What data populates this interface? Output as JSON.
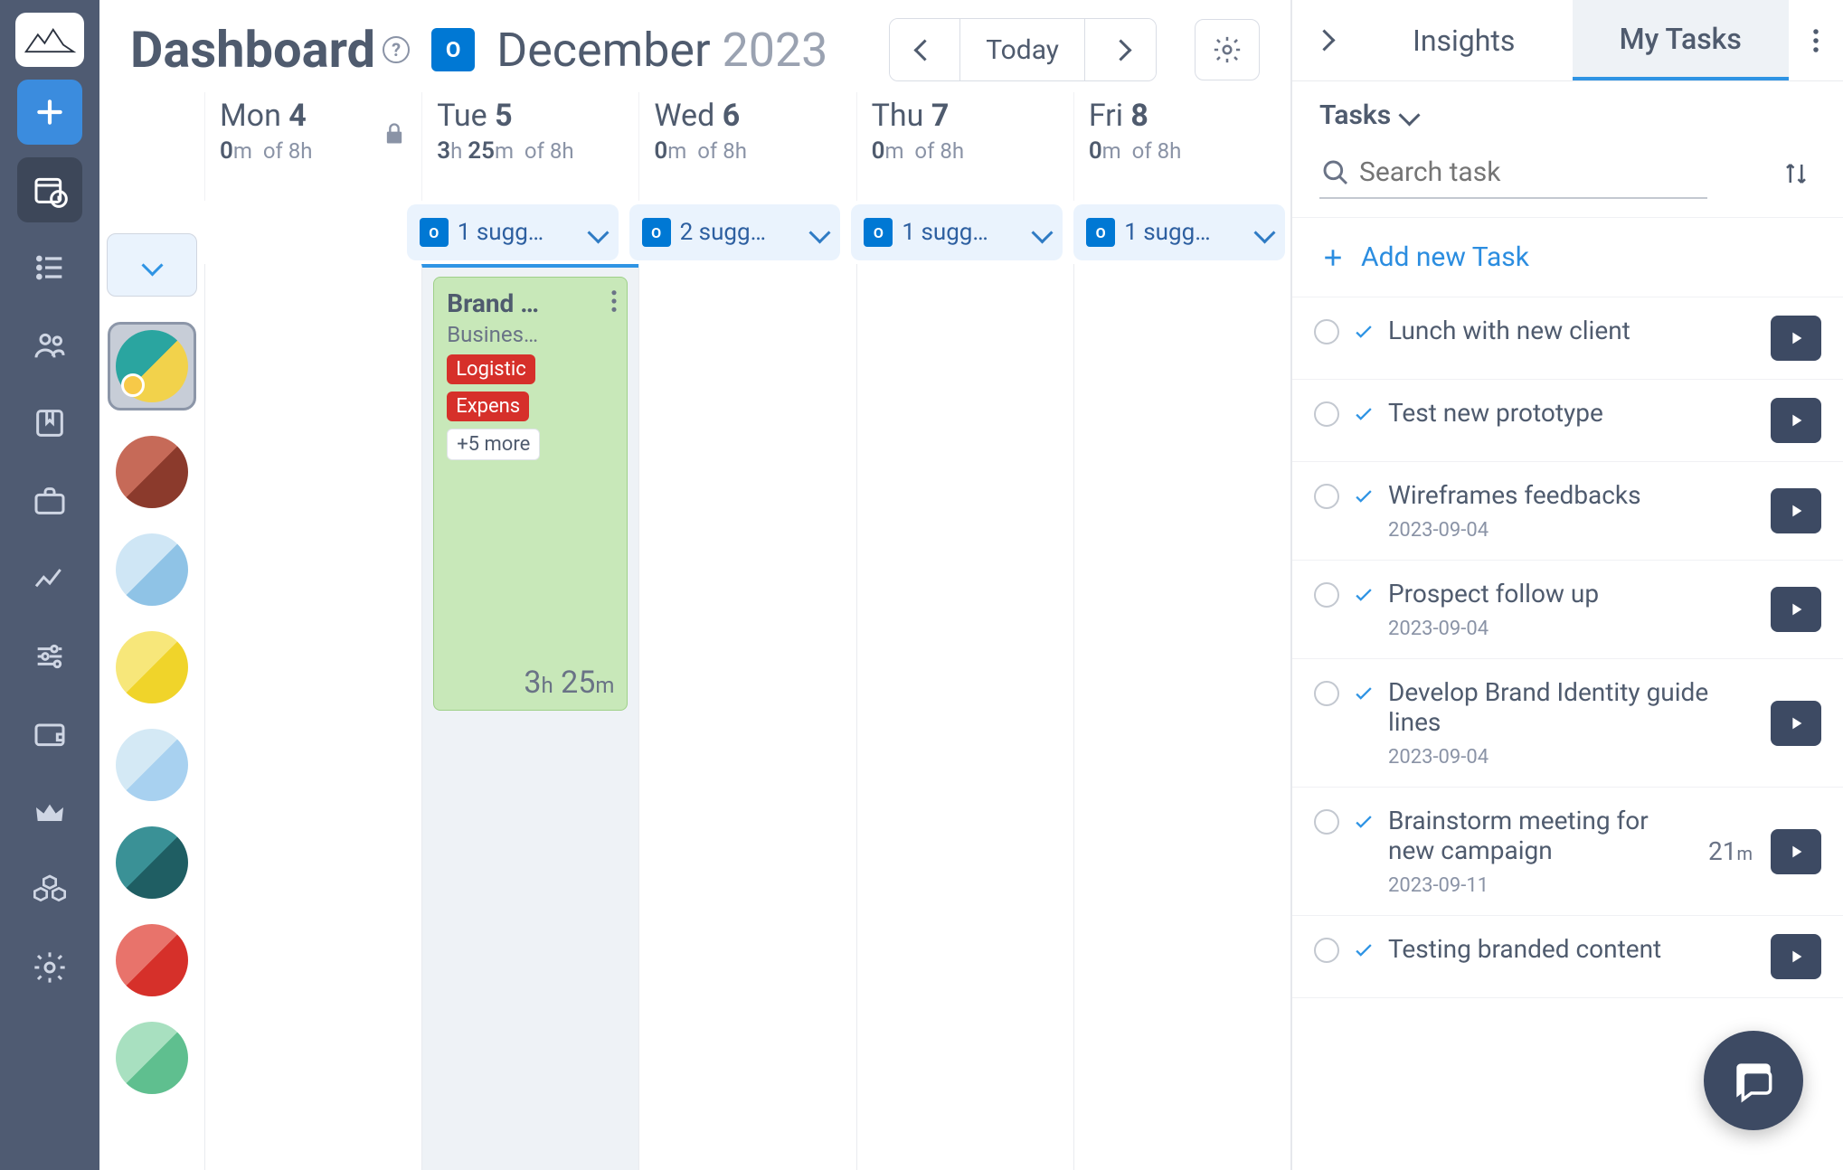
{
  "header": {
    "title": "Dashboard",
    "month": "December",
    "year": "2023",
    "today": "Today"
  },
  "days": [
    {
      "dow": "Mon",
      "num": "4",
      "hours_used": "0",
      "hours_used_unit": "m",
      "hours_total": "8",
      "hours_total_unit": "h",
      "locked": true,
      "suggestion": ""
    },
    {
      "dow": "Tue",
      "num": "5",
      "hours_used": "3",
      "hours_used_unit": "h",
      "hours_used2": "25",
      "hours_used_unit2": "m",
      "hours_total": "8",
      "hours_total_unit": "h",
      "locked": false,
      "suggestion": "1 sugg…",
      "selected": true
    },
    {
      "dow": "Wed",
      "num": "6",
      "hours_used": "0",
      "hours_used_unit": "m",
      "hours_total": "8",
      "hours_total_unit": "h",
      "locked": false,
      "suggestion": "2 sugg…"
    },
    {
      "dow": "Thu",
      "num": "7",
      "hours_used": "0",
      "hours_used_unit": "m",
      "hours_total": "8",
      "hours_total_unit": "h",
      "locked": false,
      "suggestion": "1 sugg…"
    },
    {
      "dow": "Fri",
      "num": "8",
      "hours_used": "0",
      "hours_used_unit": "m",
      "hours_total": "8",
      "hours_total_unit": "h",
      "locked": false,
      "suggestion": "1 sugg…"
    }
  ],
  "event": {
    "title": "Brand …",
    "sub": "Busines…",
    "tag1": "Logistic",
    "tag2": "Expens",
    "more": "+5 more",
    "dur_h": "3",
    "dur_h_unit": "h",
    "dur_m": "25",
    "dur_m_unit": "m"
  },
  "panel": {
    "tab1": "Insights",
    "tab2": "My Tasks",
    "filter": "Tasks",
    "search_placeholder": "Search task",
    "add": "Add new Task"
  },
  "tasks": [
    {
      "title": "Lunch with new client",
      "date": "",
      "dur": ""
    },
    {
      "title": "Test new prototype",
      "date": "",
      "dur": ""
    },
    {
      "title": "Wireframes feedbacks",
      "date": "2023-09-04",
      "dur": ""
    },
    {
      "title": "Prospect follow up",
      "date": "2023-09-04",
      "dur": ""
    },
    {
      "title": "Develop Brand Identity guide lines",
      "date": "2023-09-04",
      "dur": ""
    },
    {
      "title": "Brainstorm meeting for new campaign",
      "date": "2023-09-11",
      "dur": "21",
      "dur_unit": "m"
    },
    {
      "title": "Testing branded content",
      "date": "",
      "dur": ""
    }
  ],
  "swatches": [
    "#b24a3a",
    "#a8d1f0",
    "#f3da3f",
    "#b9dcf2",
    "#2f7d82",
    "#d6302a",
    "#5fbf8f"
  ]
}
